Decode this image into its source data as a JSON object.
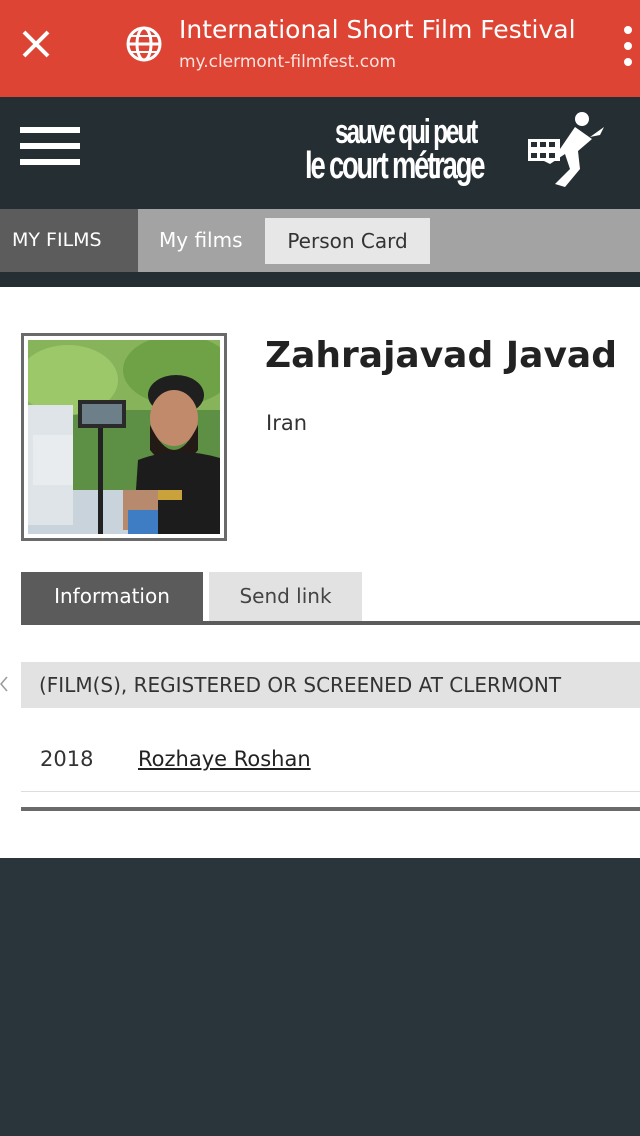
{
  "browser": {
    "title": "International Short Film Festival",
    "url": "my.clermont-filmfest.com"
  },
  "site": {
    "logo_line1": "sauve qui peut",
    "logo_line2": "le court métrage"
  },
  "nav": {
    "section_label": "MY FILMS",
    "breadcrumb_link": "My films",
    "current_tab": "Person Card"
  },
  "person": {
    "name": "Zahrajavad Javad",
    "country": "Iran"
  },
  "info_tabs": {
    "information": "Information",
    "send_link": "Send link"
  },
  "films_section": {
    "heading": "(FILM(S), REGISTERED OR SCREENED AT CLERMONT",
    "rows": [
      {
        "year": "2018",
        "title": "Rozhaye Roshan"
      }
    ]
  },
  "colors": {
    "chrome": "#de4434",
    "header": "#242e33",
    "background": "#2a353b"
  }
}
